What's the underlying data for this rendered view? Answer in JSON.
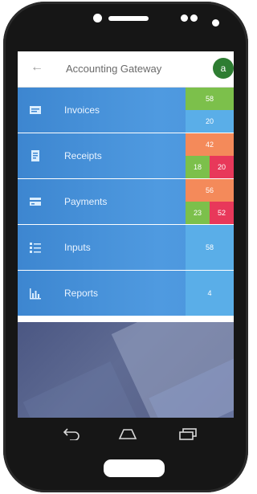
{
  "appbar": {
    "back_icon": "arrow-back-icon",
    "title": "Accounting Gateway",
    "avatar_letter": "a",
    "avatar_color": "#2e7d32"
  },
  "menu": [
    {
      "label": "Invoices",
      "icon": "invoice-icon",
      "stats": [
        {
          "value": "58",
          "color": "#7cc04b"
        },
        {
          "value": "20",
          "color": "#5aaee8"
        }
      ]
    },
    {
      "label": "Receipts",
      "icon": "receipt-icon",
      "stats": [
        {
          "value": "42",
          "color": "#f48a5a"
        },
        {
          "value": "18",
          "color": "#7cc04b"
        },
        {
          "value": "20",
          "color": "#e8385a"
        }
      ]
    },
    {
      "label": "Payments",
      "icon": "payment-card-icon",
      "stats": [
        {
          "value": "56",
          "color": "#f48a5a"
        },
        {
          "value": "23",
          "color": "#7cc04b"
        },
        {
          "value": "52",
          "color": "#e8385a"
        }
      ]
    },
    {
      "label": "Inputs",
      "icon": "checklist-icon",
      "stats": [
        {
          "value": "58",
          "color": "#5aaee8"
        }
      ]
    },
    {
      "label": "Reports",
      "icon": "bar-chart-icon",
      "stats": [
        {
          "value": "4",
          "color": "#5aaee8"
        }
      ]
    }
  ],
  "navbar": {
    "back": "nav-back-icon",
    "home": "nav-home-icon",
    "recents": "nav-recents-icon"
  }
}
